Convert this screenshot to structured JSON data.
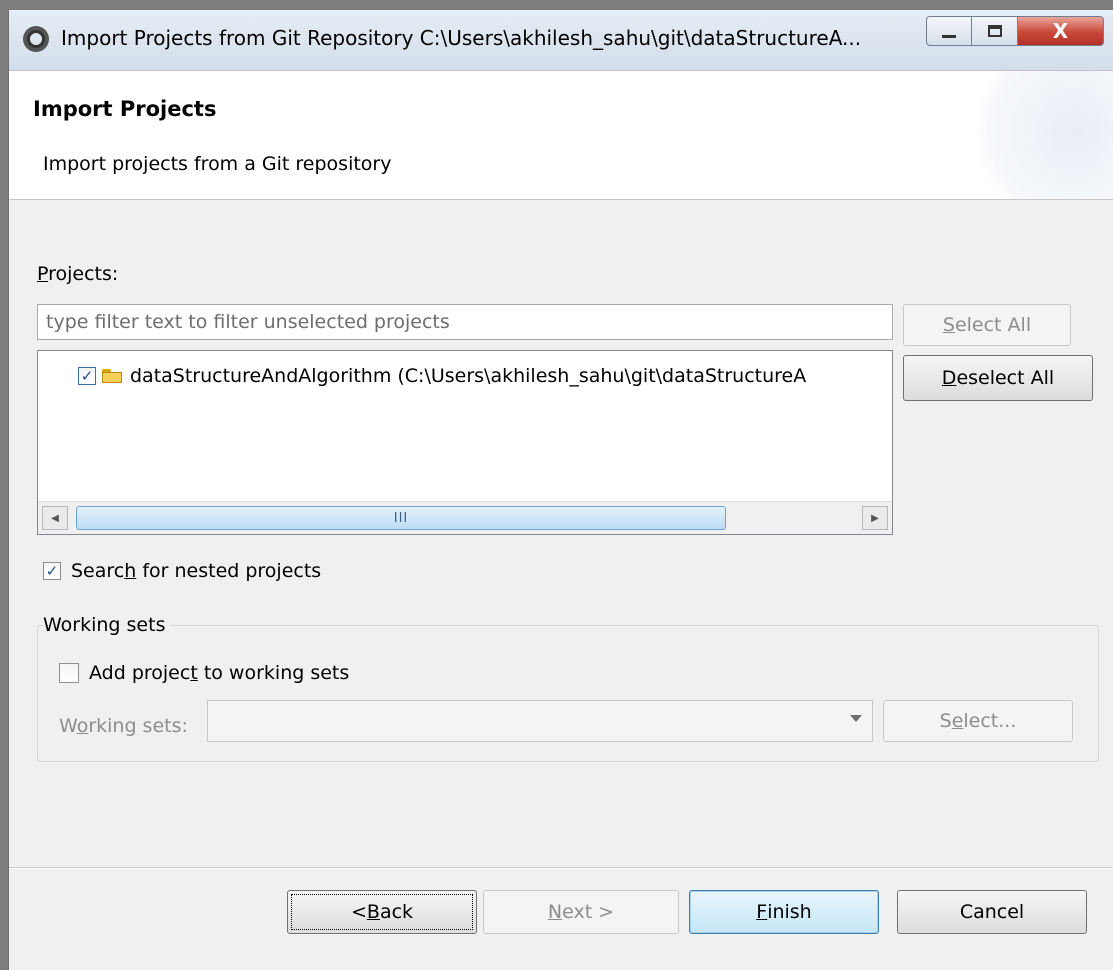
{
  "window": {
    "title": "Import Projects from Git Repository C:\\Users\\akhilesh_sahu\\git\\dataStructureA...",
    "close_glyph": "X"
  },
  "banner": {
    "title": "Import Projects",
    "subtitle": "Import projects from a Git repository"
  },
  "projects": {
    "label_access": "P",
    "label_rest": "rojects:",
    "filter_placeholder": "type filter text to filter unselected projects",
    "items": [
      {
        "label": "dataStructureAndAlgorithm (C:\\Users\\akhilesh_sahu\\git\\dataStructureA",
        "checked": true
      }
    ],
    "scroll_thumb_glyph": "III",
    "scroll_left_glyph": "◀",
    "scroll_right_glyph": "▶"
  },
  "buttons": {
    "select_all_access": "S",
    "select_all_rest": "elect All",
    "deselect_all_access": "D",
    "deselect_all_rest": "eselect All",
    "back_pre": "< ",
    "back_access": "B",
    "back_rest": "ack",
    "next_access": "N",
    "next_rest": "ext >",
    "finish_access": "F",
    "finish_rest": "inish",
    "cancel": "Cancel",
    "select_pre": "S",
    "select_access": "e",
    "select_rest": "lect..."
  },
  "nested": {
    "pre": "Searc",
    "access": "h",
    "post": " for nested projects",
    "checked": true,
    "check_glyph": "✓"
  },
  "working_sets": {
    "group_title": "Working sets",
    "add_pre": "Add projec",
    "add_access": "t",
    "add_post": " to working sets",
    "add_checked": false,
    "field_pre": "W",
    "field_access": "o",
    "field_post": "rking sets:",
    "value": ""
  }
}
